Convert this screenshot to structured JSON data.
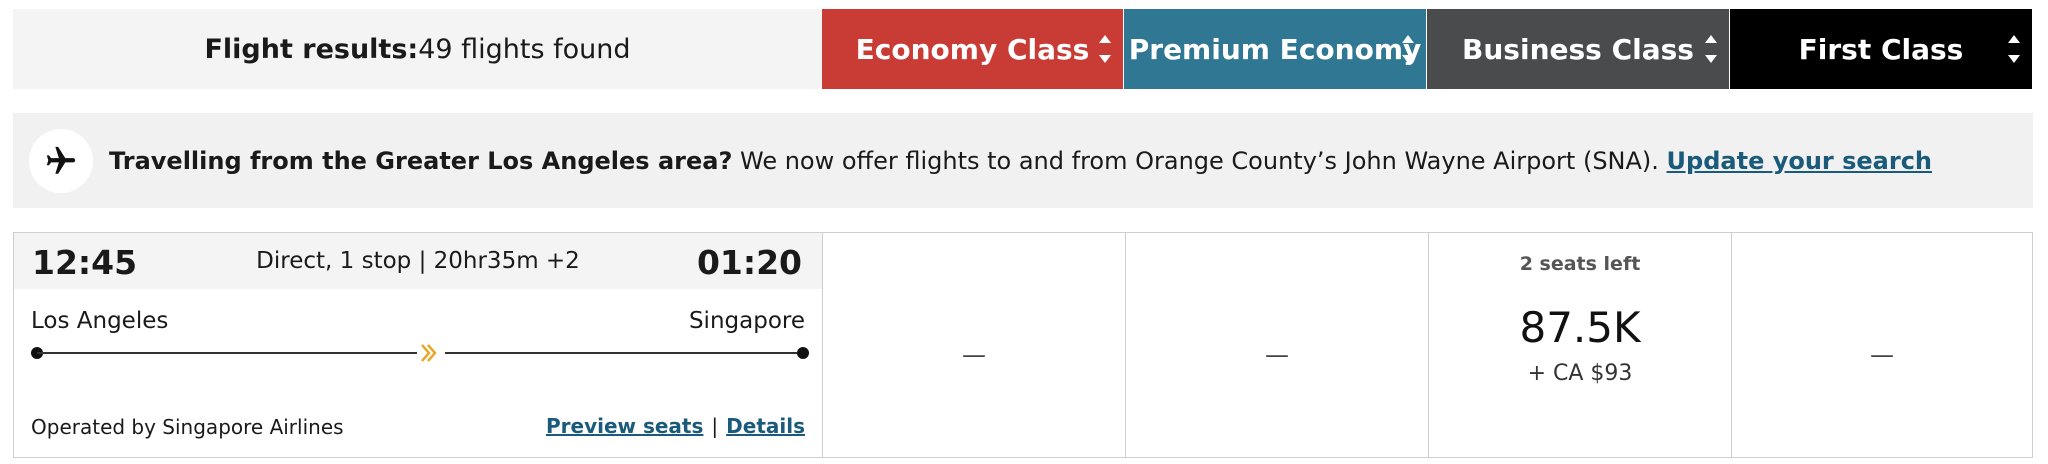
{
  "header": {
    "results_label": "Flight results:",
    "results_count": "49 flights found",
    "classes": [
      {
        "label": "Economy Class",
        "color": "#c93b35"
      },
      {
        "label": "Premium Economy",
        "color": "#2f7793"
      },
      {
        "label": "Business Class",
        "color": "#4a4b4d"
      },
      {
        "label": "First Class",
        "color": "#000000"
      }
    ]
  },
  "banner": {
    "icon": "airplane-icon",
    "bold_text": "Travelling from the Greater Los Angeles area?",
    "text": " We now offer flights to and from Orange County’s John Wayne Airport (SNA). ",
    "link_text": "Update your search"
  },
  "flight": {
    "departure_time": "12:45",
    "arrival_time": "01:20",
    "summary": "Direct, 1 stop | 20hr35m +2",
    "origin": "Los Angeles",
    "destination": "Singapore",
    "operated_by": "Operated by Singapore Airlines",
    "preview_seats": "Preview seats",
    "separator": "|",
    "details": "Details",
    "fares": {
      "economy": "—",
      "premium": "—",
      "business": {
        "seats_left": "2 seats left",
        "price": "87.5K",
        "tax": "+ CA $93"
      },
      "first": "—"
    }
  }
}
